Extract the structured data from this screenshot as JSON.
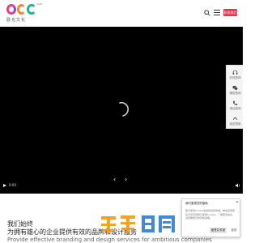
{
  "header": {
    "logo_text": "歐也文化",
    "logo_trademark": "OCE",
    "contact_label": "联系我们"
  },
  "video": {
    "time_label": "0:00",
    "prev_label": "‹",
    "next_label": "›"
  },
  "float_bar": {
    "items": [
      {
        "label": "在线咨询",
        "icon": "headset-icon"
      },
      {
        "label": "微信咨询",
        "icon": "wechat-icon"
      },
      {
        "label": "电话咨询",
        "icon": "phone-icon"
      },
      {
        "label": "返回顶部",
        "icon": "arrow-up-icon"
      }
    ]
  },
  "section": {
    "title": "我们始终",
    "subtitle": "为拥有雄心的企业提供有效的品牌和设计服务",
    "english": "Provide effective branding and design services for ambitious companies"
  },
  "cookie": {
    "title": "我们重视您的隐私",
    "close_label": "✕",
    "text": "我们使用Cookie来提供最佳体验。单击接受即表示您同意我们使用Cookie。了解更多信息，请查看我们的隐私政策。",
    "accept_label": "接受并关闭",
    "decline_label": "拒绝"
  },
  "colors": {
    "brand_pink": "#e83e8c",
    "brand_orange": "#f08a24",
    "brand_teal": "#19b6a6",
    "contact_red": "#e8344e",
    "watermark_orange": "#f39c12",
    "watermark_blue": "#2f7fd8"
  }
}
